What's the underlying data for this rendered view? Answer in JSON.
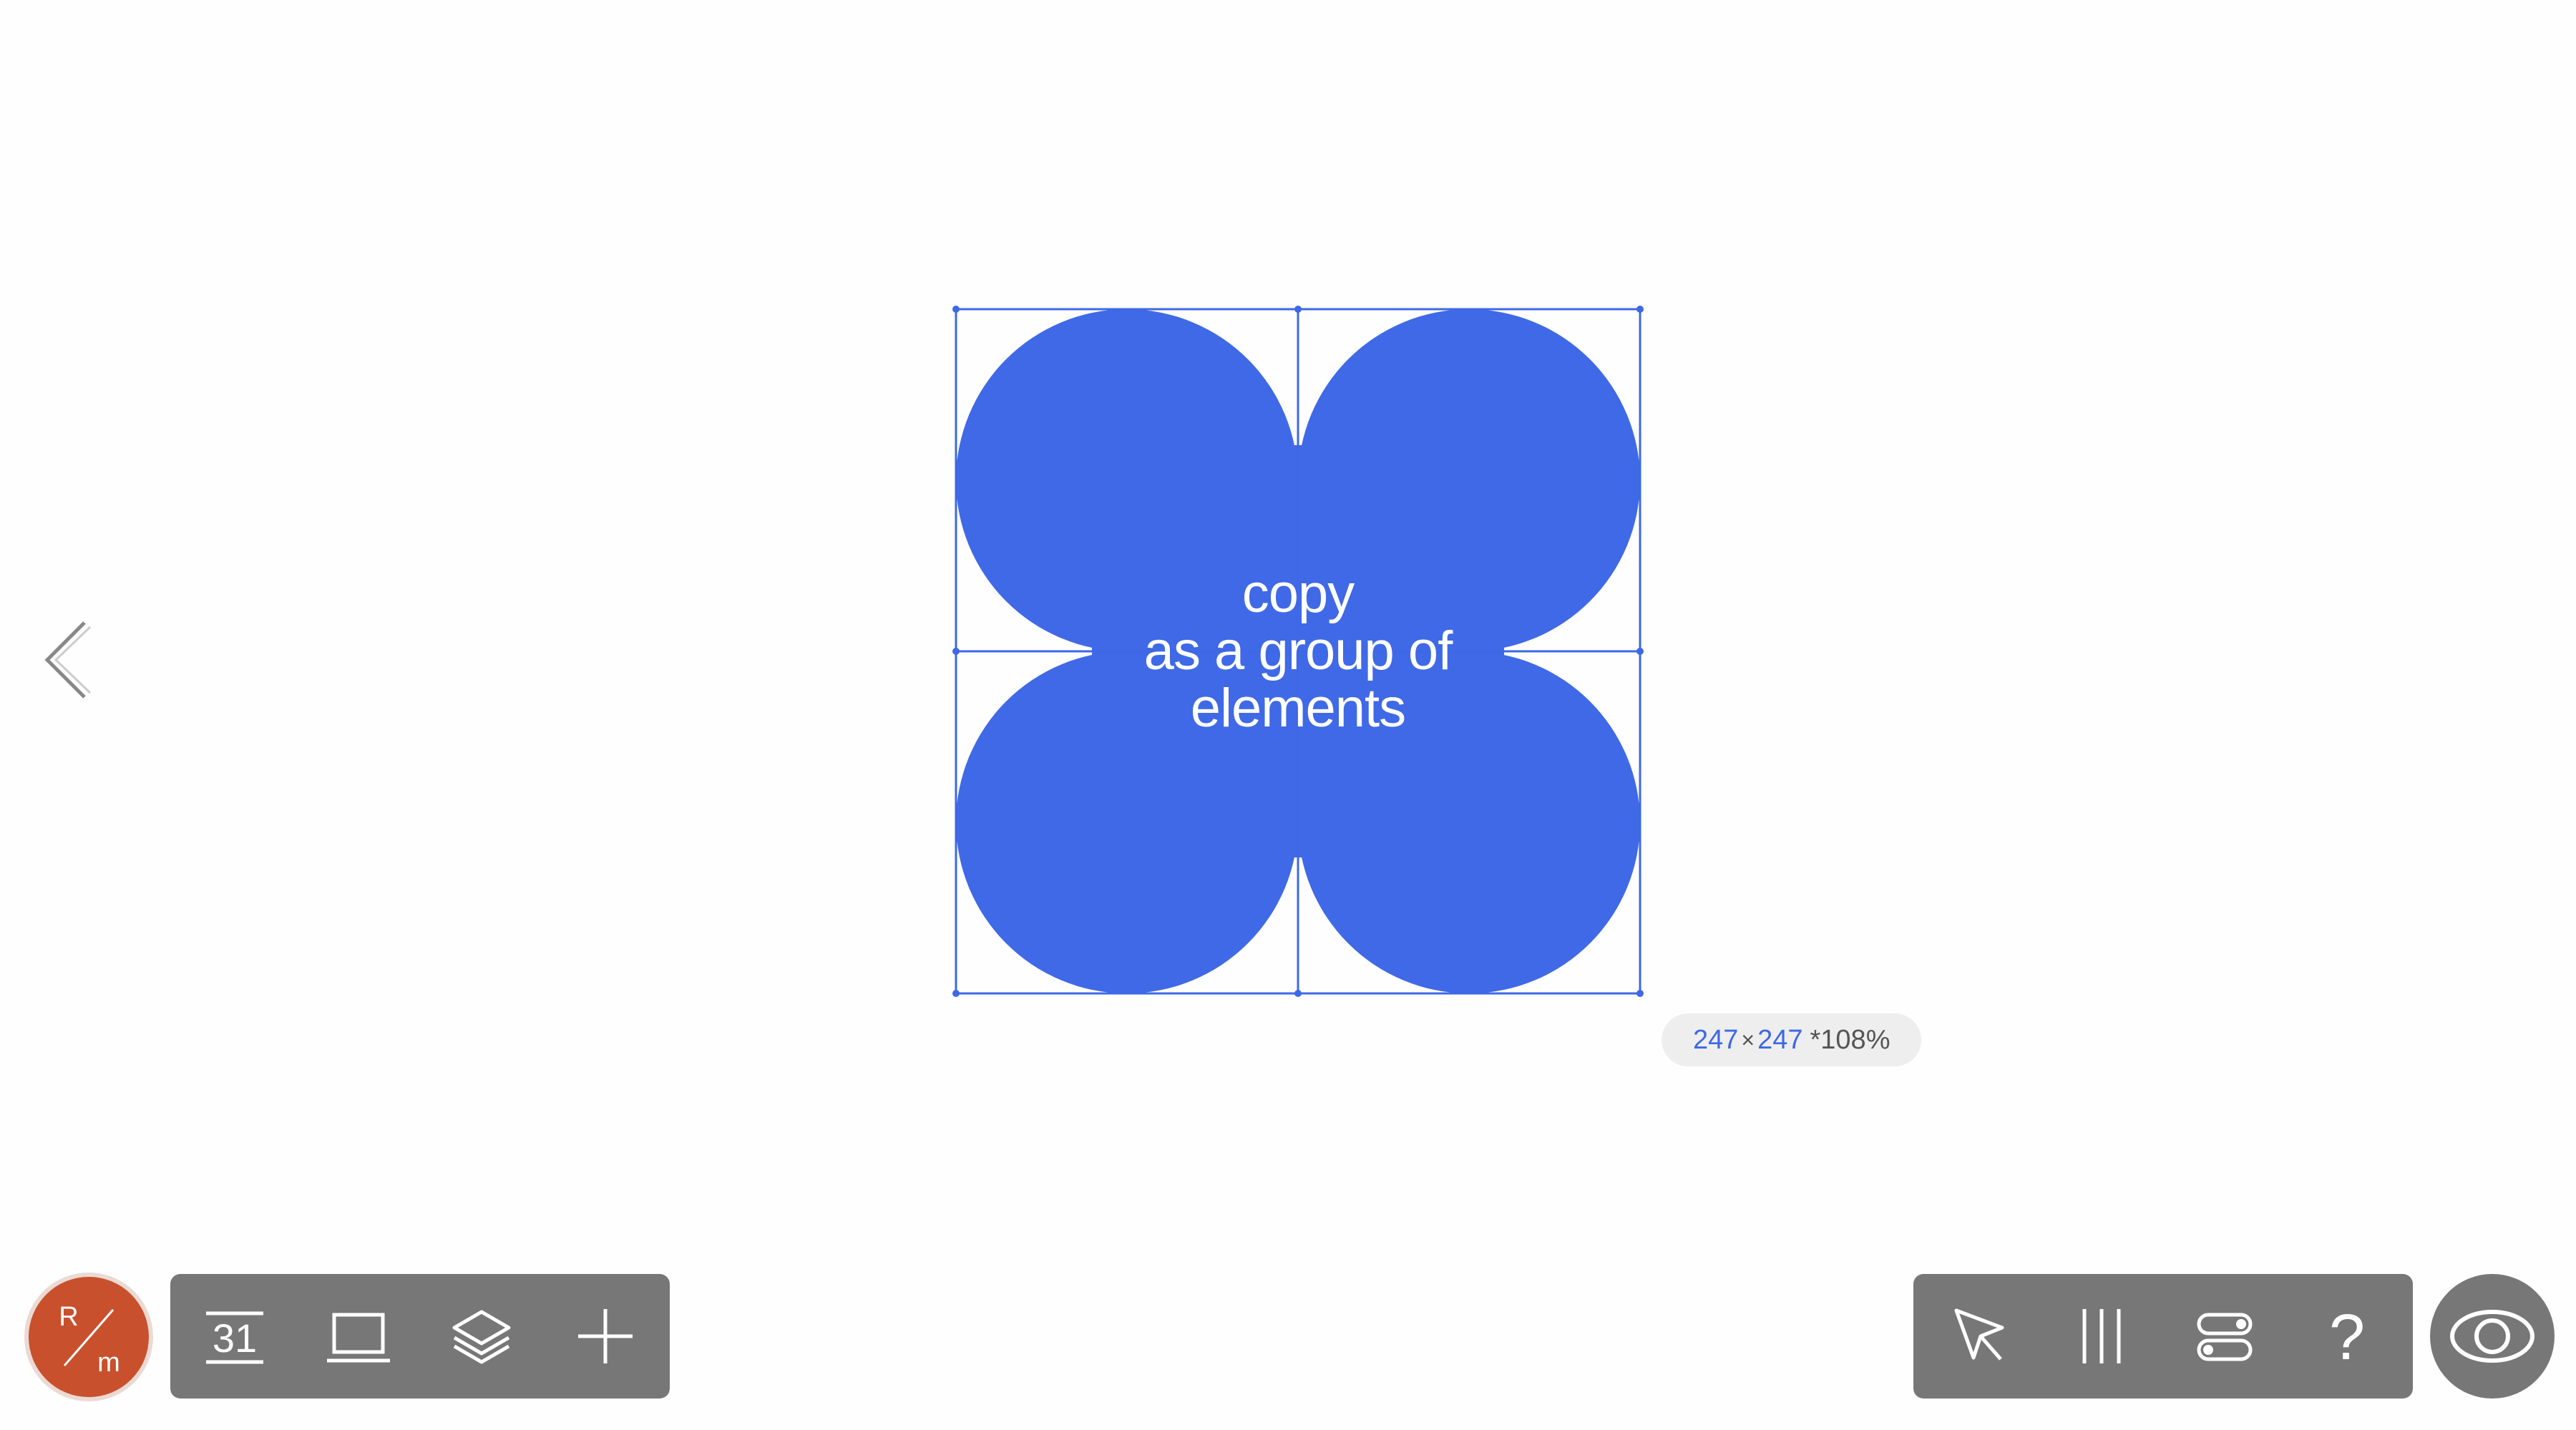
{
  "canvas": {
    "shape_label_lines": [
      "copy",
      "as a group of",
      "elements"
    ],
    "accent_color": "#3d68e6"
  },
  "size_badge": {
    "width": "247",
    "times": "×",
    "height": "247",
    "zoom": "*108%"
  },
  "avatar": {
    "initial_top": "R",
    "initial_bottom": "m",
    "color": "#c8502c"
  },
  "left_toolbar": {
    "items": [
      {
        "icon": "calendar-icon",
        "text": "31"
      },
      {
        "icon": "laptop-icon"
      },
      {
        "icon": "layers-icon"
      },
      {
        "icon": "plus-icon"
      }
    ]
  },
  "right_toolbar": {
    "items": [
      {
        "icon": "cursor-icon"
      },
      {
        "icon": "columns-icon"
      },
      {
        "icon": "toggles-icon"
      },
      {
        "icon": "help-icon",
        "text": "?"
      }
    ]
  },
  "preview": {
    "icon": "eye-icon"
  },
  "navigation": {
    "back": {
      "icon": "chevron-left-icon"
    }
  }
}
